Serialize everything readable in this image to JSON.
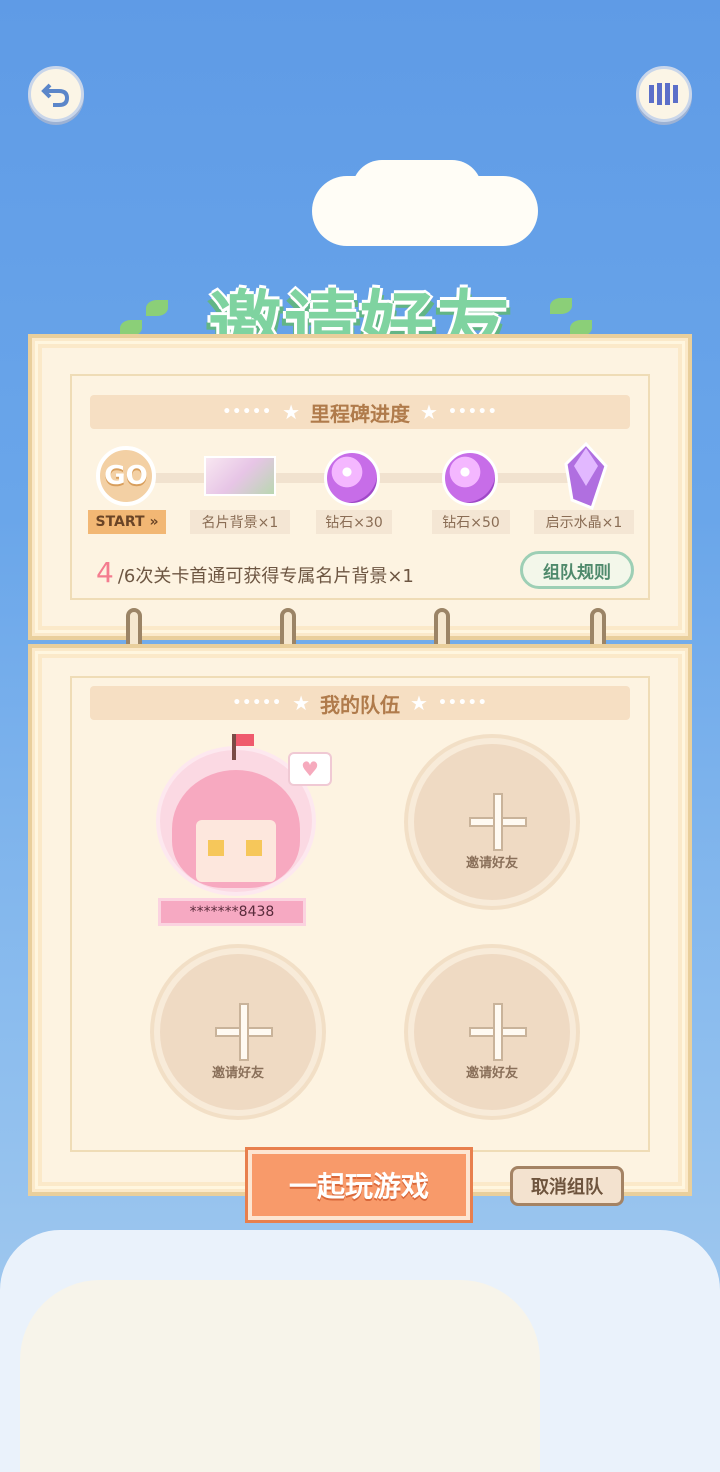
{
  "header": {
    "back_icon": "undo-arrow-icon",
    "menu_icon": "bars-icon"
  },
  "title": "邀请好友",
  "milestone": {
    "header": "里程碑进度",
    "start_badge": "GO",
    "start_label": "START »",
    "rewards": [
      {
        "label": "名片背景×1",
        "icon": "card-background-icon"
      },
      {
        "label": "钻石×30",
        "icon": "diamond-icon"
      },
      {
        "label": "钻石×50",
        "icon": "diamond-icon"
      },
      {
        "label": "启示水晶×1",
        "icon": "crystal-icon"
      }
    ],
    "progress_current": "4",
    "progress_text": "/6次关卡首通可获得专属名片背景×1",
    "rules_button": "组队规则"
  },
  "team": {
    "header": "我的队伍",
    "member_name": "*******8438",
    "invite_label": "邀请好友"
  },
  "actions": {
    "play_button": "一起玩游戏",
    "cancel_button": "取消组队"
  }
}
